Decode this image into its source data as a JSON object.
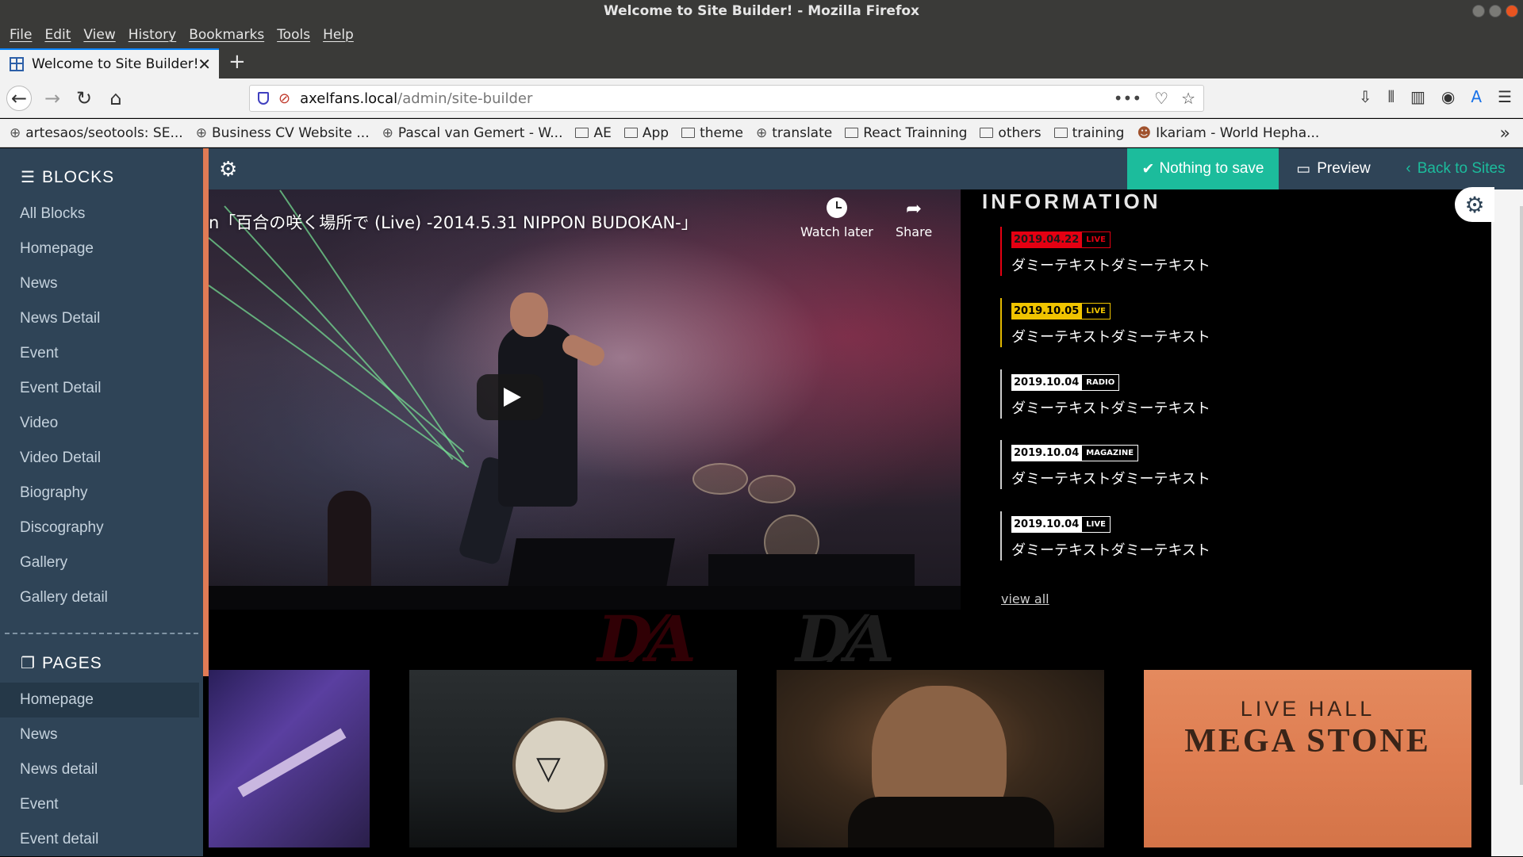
{
  "window": {
    "title": "Welcome to Site Builder! - Mozilla Firefox"
  },
  "menu": [
    "File",
    "Edit",
    "View",
    "History",
    "Bookmarks",
    "Tools",
    "Help"
  ],
  "tab": {
    "title": "Welcome to Site Builder!"
  },
  "url": {
    "host": "axelfans.local",
    "path": "/admin/site-builder"
  },
  "bookmarks": [
    {
      "label": "artesaos/seotools: SE...",
      "icon": "globe-icon"
    },
    {
      "label": "Business CV Website ...",
      "icon": "globe-icon"
    },
    {
      "label": "Pascal van Gemert - W...",
      "icon": "globe-icon"
    },
    {
      "label": "AE",
      "icon": "folder-icon"
    },
    {
      "label": "App",
      "icon": "folder-icon"
    },
    {
      "label": "theme",
      "icon": "folder-icon"
    },
    {
      "label": "translate",
      "icon": "globe-icon"
    },
    {
      "label": "React Trainning",
      "icon": "folder-icon"
    },
    {
      "label": "others",
      "icon": "folder-icon"
    },
    {
      "label": "training",
      "icon": "folder-icon"
    },
    {
      "label": "Ikariam - World Hepha...",
      "icon": "avatar-icon"
    }
  ],
  "sidebar": {
    "blocks_heading": "BLOCKS",
    "blocks": [
      "All Blocks",
      "Homepage",
      "News",
      "News Detail",
      "Event",
      "Event Detail",
      "Video",
      "Video Detail",
      "Biography",
      "Discography",
      "Gallery",
      "Gallery detail"
    ],
    "pages_heading": "PAGES",
    "pages": [
      "Homepage",
      "News",
      "News detail",
      "Event",
      "Event detail"
    ],
    "active_page": "Homepage"
  },
  "toolbar": {
    "save_label": "Nothing to save",
    "preview_label": "Preview",
    "back_label": "Back to Sites"
  },
  "video": {
    "title": "n「百合の咲く場所で (Live) -2014.5.31 NIPPON BUDOKAN-」",
    "watch_later": "Watch later",
    "share": "Share"
  },
  "information": {
    "title": "INFORMATION",
    "items": [
      {
        "date": "2019.04.22",
        "type": "LIVE",
        "text": "ダミーテキストダミーテキスト",
        "color": "#e50012"
      },
      {
        "date": "2019.10.05",
        "type": "LIVE",
        "text": "ダミーテキストダミーテキスト",
        "color": "#f0c400"
      },
      {
        "date": "2019.10.04",
        "type": "RADIO",
        "text": "ダミーテキストダミーテキスト",
        "color": "#ffffff"
      },
      {
        "date": "2019.10.04",
        "type": "MAGAZINE",
        "text": "ダミーテキストダミーテキスト",
        "color": "#ffffff"
      },
      {
        "date": "2019.10.04",
        "type": "LIVE",
        "text": "ダミーテキストダミーテキスト",
        "color": "#ffffff"
      }
    ],
    "view_all": "view all"
  },
  "gallery": {
    "hall_line1": "LIVE HALL",
    "hall_line2": "MEGA STONE"
  },
  "colors": {
    "sidebar_bg": "#2f4457",
    "save_green": "#1cbc9c",
    "accent_orange": "#e17b55",
    "live_red": "#e50012",
    "live_yellow": "#f0c400"
  }
}
